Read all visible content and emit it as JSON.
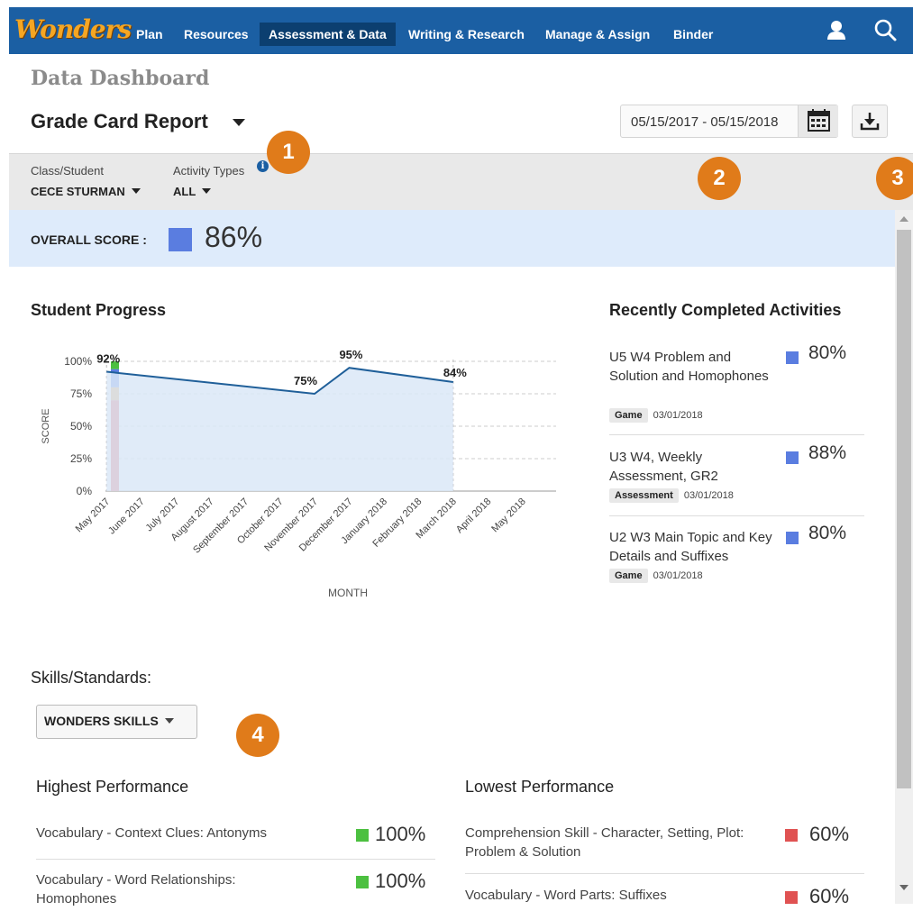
{
  "nav": {
    "logo": "Wonders",
    "items": [
      "Plan",
      "Resources",
      "Assessment & Data",
      "Writing & Research",
      "Manage & Assign",
      "Binder"
    ],
    "active": "Assessment & Data"
  },
  "header": {
    "dashboard_title": "Data Dashboard",
    "report_title": "Grade Card Report",
    "date_range": "05/15/2017 - 05/15/2018"
  },
  "filters": {
    "class_student_label": "Class/Student",
    "class_student_value": "CECE STURMAN",
    "activity_types_label": "Activity Types",
    "activity_types_value": "ALL",
    "info_glyph": "i"
  },
  "callouts": [
    "1",
    "2",
    "3",
    "4"
  ],
  "overall": {
    "label": "OVERALL SCORE :",
    "value": "86%",
    "color": "#5a7de0"
  },
  "progress": {
    "heading": "Student Progress",
    "chart_data": {
      "type": "area",
      "ylabel": "SCORE",
      "xlabel": "MONTH",
      "yticks": [
        "100%",
        "75%",
        "50%",
        "25%",
        "0%"
      ],
      "ylim": [
        0,
        100
      ],
      "categories": [
        "May 2017",
        "June 2017",
        "July 2017",
        "August 2017",
        "September 2017",
        "October 2017",
        "November 2017",
        "December 2017",
        "January 2018",
        "February 2018",
        "March 2018",
        "April 2018",
        "May 2018"
      ],
      "points": [
        {
          "x": "May 2017",
          "y": 92,
          "label": "92%"
        },
        {
          "x": "November 2017",
          "y": 75,
          "label": "75%"
        },
        {
          "x": "December 2017",
          "y": 95,
          "label": "95%"
        },
        {
          "x": "March 2018",
          "y": 84,
          "label": "84%"
        }
      ],
      "legend_bar": [
        {
          "color": "#e05252",
          "value": 70
        },
        {
          "color": "#e0a24e",
          "value": 10
        },
        {
          "color": "#5a7de0",
          "value": 14
        },
        {
          "color": "#4cc040",
          "value": 6
        }
      ],
      "line_color": "#1f5f99",
      "fill_color": "#dbe8f7",
      "grid": true
    }
  },
  "recent": {
    "heading": "Recently Completed Activities",
    "items": [
      {
        "title": "U5 W4 Problem and Solution and Homophones",
        "tag": "Game",
        "date": "03/01/2018",
        "score": "80%"
      },
      {
        "title": "U3 W4, Weekly Assessment, GR2",
        "tag": "Assessment",
        "date": "03/01/2018",
        "score": "88%"
      },
      {
        "title": "U2 W3 Main Topic and Key Details and Suffixes",
        "tag": "Game",
        "date": "03/01/2018",
        "score": "80%"
      }
    ],
    "score_color": "#5a7de0"
  },
  "skills": {
    "heading": "Skills/Standards:",
    "dropdown": "WONDERS SKILLS",
    "highest": {
      "heading": "Highest Performance",
      "color": "#4cc040",
      "items": [
        {
          "label": "Vocabulary - Context Clues: Antonyms",
          "value": "100%"
        },
        {
          "label": "Vocabulary - Word Relationships: Homophones",
          "value": "100%"
        }
      ]
    },
    "lowest": {
      "heading": "Lowest Performance",
      "color": "#e05252",
      "items": [
        {
          "label": "Comprehension Skill - Character, Setting, Plot: Problem & Solution",
          "value": "60%"
        },
        {
          "label": "Vocabulary - Word Parts: Suffixes",
          "value": "60%"
        }
      ]
    }
  }
}
